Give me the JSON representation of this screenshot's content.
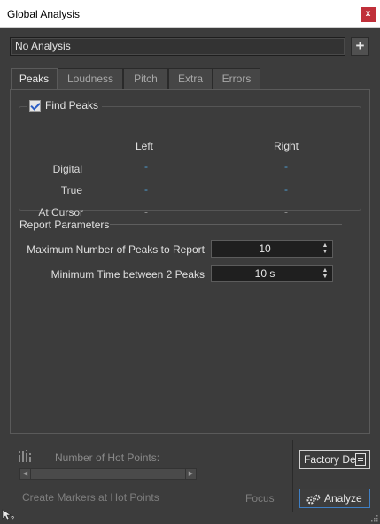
{
  "window": {
    "title": "Global Analysis",
    "close_glyph": "x"
  },
  "preset": {
    "value": "No Analysis",
    "add_glyph": "+"
  },
  "tabs": [
    {
      "label": "Peaks",
      "active": true
    },
    {
      "label": "Loudness",
      "active": false
    },
    {
      "label": "Pitch",
      "active": false
    },
    {
      "label": "Extra",
      "active": false
    },
    {
      "label": "Errors",
      "active": false
    }
  ],
  "peaks": {
    "find_peaks_label": "Find Peaks",
    "find_peaks_checked": true,
    "col_left": "Left",
    "col_right": "Right",
    "rows": [
      {
        "label": "Digital",
        "left": "-",
        "right": "-"
      },
      {
        "label": "True",
        "left": "-",
        "right": "-"
      },
      {
        "label": "At Cursor",
        "left": "-",
        "right": "-"
      }
    ]
  },
  "report": {
    "title": "Report Parameters",
    "max_peaks_label": "Maximum Number of Peaks to Report",
    "max_peaks_value": "10",
    "min_time_label": "Minimum Time between 2 Peaks",
    "min_time_value": "10 s"
  },
  "bottom": {
    "hot_points_label": "Number of Hot Points:",
    "create_markers_label": "Create Markers at Hot Points",
    "focus_label": "Focus",
    "factory_label": "Factory De",
    "analyze_label": "Analyze"
  },
  "colors": {
    "background": "#3c3c3c",
    "value_blue": "#4ea0d6",
    "close_red": "#c0303a",
    "analyze_border": "#3f7fc4"
  }
}
